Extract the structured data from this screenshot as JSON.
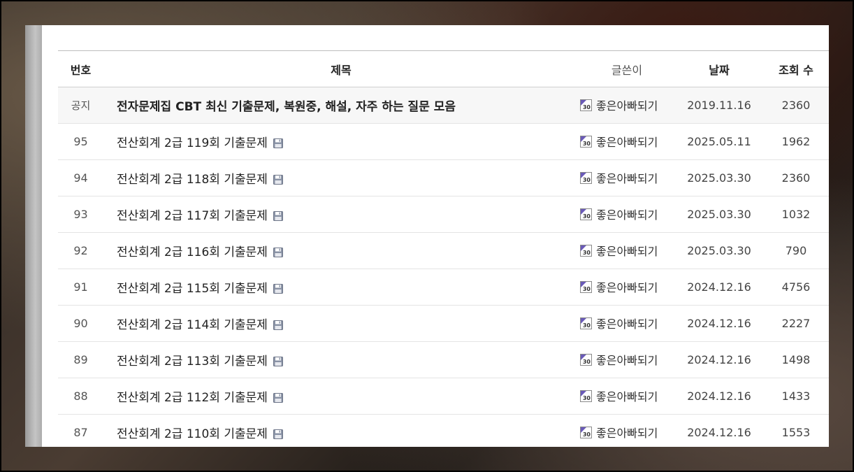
{
  "board": {
    "headers": {
      "num": "번호",
      "title": "제목",
      "author": "글쓴이",
      "date": "날짜",
      "views": "조회 수"
    },
    "notice": {
      "num": "공지",
      "title": "전자문제집 CBT 최신 기출문제, 복원중, 해설, 자주 하는 질문 모음",
      "author": "좋은아빠되기",
      "date": "2019.11.16",
      "views": "2360"
    },
    "rows": [
      {
        "num": "95",
        "title": "전산회계 2급 119회 기출문제",
        "author": "좋은아빠되기",
        "date": "2025.05.11",
        "views": "1962"
      },
      {
        "num": "94",
        "title": "전산회계 2급 118회 기출문제",
        "author": "좋은아빠되기",
        "date": "2025.03.30",
        "views": "2360"
      },
      {
        "num": "93",
        "title": "전산회계 2급 117회 기출문제",
        "author": "좋은아빠되기",
        "date": "2025.03.30",
        "views": "1032"
      },
      {
        "num": "92",
        "title": "전산회계 2급 116회 기출문제",
        "author": "좋은아빠되기",
        "date": "2025.03.30",
        "views": "790"
      },
      {
        "num": "91",
        "title": "전산회계 2급 115회 기출문제",
        "author": "좋은아빠되기",
        "date": "2024.12.16",
        "views": "4756"
      },
      {
        "num": "90",
        "title": "전산회계 2급 114회 기출문제",
        "author": "좋은아빠되기",
        "date": "2024.12.16",
        "views": "2227"
      },
      {
        "num": "89",
        "title": "전산회계 2급 113회 기출문제",
        "author": "좋은아빠되기",
        "date": "2024.12.16",
        "views": "1498"
      },
      {
        "num": "88",
        "title": "전산회계 2급 112회 기출문제",
        "author": "좋은아빠되기",
        "date": "2024.12.16",
        "views": "1433"
      },
      {
        "num": "87",
        "title": "전산회계 2급 110회 기출문제",
        "author": "좋은아빠되기",
        "date": "2024.12.16",
        "views": "1553"
      }
    ],
    "level_badge": "30",
    "icons": {
      "attachment": "floppy-disk-icon",
      "level": "member-level-icon"
    },
    "colors": {
      "level_accent": "#6a5ab8",
      "attachment_icon": "#8a93a6",
      "notice_bg": "#f7f7f7"
    }
  }
}
